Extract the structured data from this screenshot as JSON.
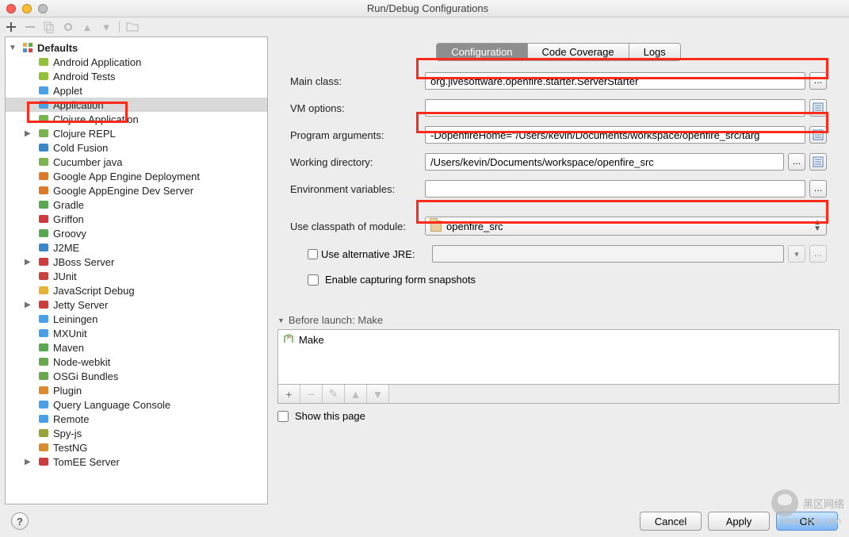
{
  "window": {
    "title": "Run/Debug Configurations"
  },
  "tabs": {
    "config": "Configuration",
    "coverage": "Code Coverage",
    "logs": "Logs"
  },
  "tree": {
    "root": "Defaults",
    "items": [
      "Android Application",
      "Android Tests",
      "Applet",
      "Application",
      "Clojure Application",
      "Clojure REPL",
      "Cold Fusion",
      "Cucumber java",
      "Google App Engine Deployment",
      "Google AppEngine Dev Server",
      "Gradle",
      "Griffon",
      "Groovy",
      "J2ME",
      "JBoss Server",
      "JUnit",
      "JavaScript Debug",
      "Jetty Server",
      "Leiningen",
      "MXUnit",
      "Maven",
      "Node-webkit",
      "OSGi Bundles",
      "Plugin",
      "Query Language Console",
      "Remote",
      "Spy-js",
      "TestNG",
      "TomEE Server"
    ]
  },
  "form": {
    "main_class_label": "Main class:",
    "main_class_value": "org.jivesoftware.openfire.starter.ServerStarter",
    "vm_label": "VM options:",
    "vm_value": "",
    "args_label": "Program arguments:",
    "args_value": "-DopenfireHome=\"/Users/kevin/Documents/workspace/openfire_src/targ",
    "wd_label": "Working directory:",
    "wd_value": "/Users/kevin/Documents/workspace/openfire_src",
    "env_label": "Environment variables:",
    "env_value": "",
    "module_label": "Use classpath of module:",
    "module_value": "openfire_src",
    "alt_jre_label": "Use alternative JRE:",
    "snapshots_label": "Enable capturing form snapshots"
  },
  "before_launch": {
    "header": "Before launch: Make",
    "item": "Make"
  },
  "show_this_page": "Show this page",
  "footer": {
    "cancel": "Cancel",
    "apply": "Apply",
    "ok": "OK"
  },
  "watermark": {
    "text": "黑区网络",
    "sub": "www.heiqu.com"
  }
}
